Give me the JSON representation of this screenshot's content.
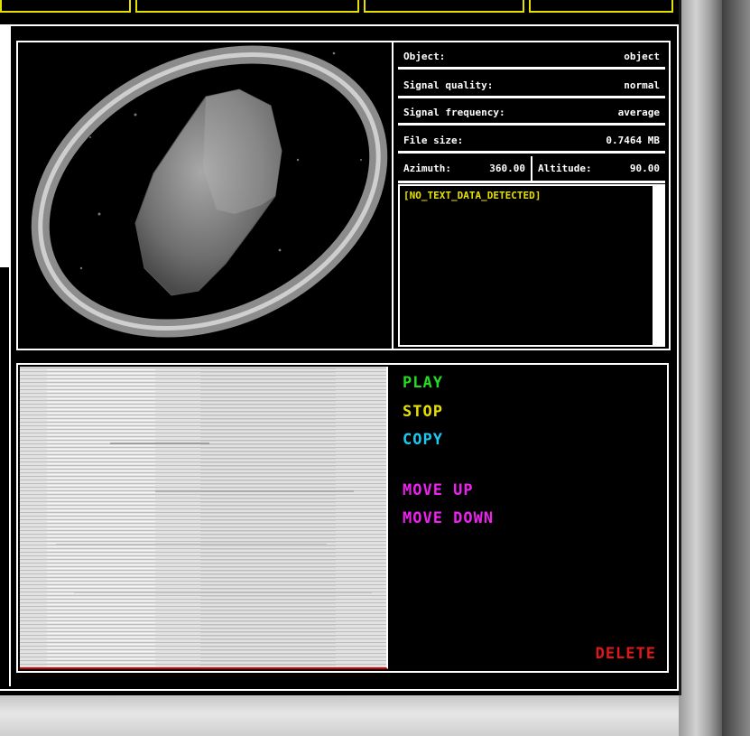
{
  "info": {
    "object_label": "Object:",
    "object_value": "object",
    "signal_quality_label": "Signal quality:",
    "signal_quality_value": "normal",
    "signal_frequency_label": "Signal frequency:",
    "signal_frequency_value": "average",
    "file_size_label": "File size:",
    "file_size_value": "0.7464 MB",
    "azimuth_label": "Azimuth:",
    "azimuth_value": "360.00",
    "altitude_label": "Altitude:",
    "altitude_value": "90.00"
  },
  "text_output": "[NO_TEXT_DATA_DETECTED]",
  "controls": {
    "play": "PLAY",
    "stop": "STOP",
    "copy": "COPY",
    "move_up": "MOVE UP",
    "move_down": "MOVE DOWN",
    "delete": "DELETE"
  },
  "colors": {
    "play": "#22dd22",
    "stop": "#e6e000",
    "copy": "#1ec8f0",
    "move": "#ee22ee",
    "delete": "#e01818",
    "text_output": "#e6e000"
  }
}
